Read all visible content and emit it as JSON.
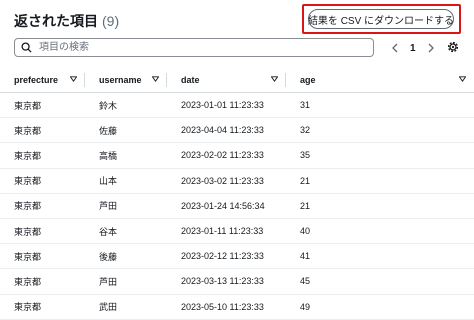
{
  "header": {
    "title": "返された項目",
    "count": "(9)"
  },
  "toolbar": {
    "download_label": "結果を CSV にダウンロードする"
  },
  "search": {
    "placeholder": "項目の検索"
  },
  "pagination": {
    "current_page": "1"
  },
  "table": {
    "columns": [
      "prefecture",
      "username",
      "date",
      "age"
    ],
    "rows": [
      [
        "東京都",
        "鈴木",
        "2023-01-01 11:23:33",
        "31"
      ],
      [
        "東京都",
        "佐藤",
        "2023-04-04 11:23:33",
        "32"
      ],
      [
        "東京都",
        "高橋",
        "2023-02-02 11:23:33",
        "35"
      ],
      [
        "東京都",
        "山本",
        "2023-03-02 11:23:33",
        "21"
      ],
      [
        "東京都",
        "芦田",
        "2023-01-24 14:56:34",
        "21"
      ],
      [
        "東京都",
        "谷本",
        "2023-01-11 11:23:33",
        "40"
      ],
      [
        "東京都",
        "後藤",
        "2023-02-12 11:23:33",
        "41"
      ],
      [
        "東京都",
        "芦田",
        "2023-03-13 11:23:33",
        "45"
      ],
      [
        "東京都",
        "武田",
        "2023-05-10 11:23:33",
        "49"
      ]
    ]
  },
  "icons": {
    "search": "search-icon",
    "prev": "chevron-left-icon",
    "next": "chevron-right-icon",
    "settings": "gear-icon",
    "sort": "sort-caret-icon"
  },
  "colors": {
    "highlight": "#d91515",
    "text": "#16191f",
    "muted": "#5f6b7a",
    "border": "#d5dbdb"
  }
}
